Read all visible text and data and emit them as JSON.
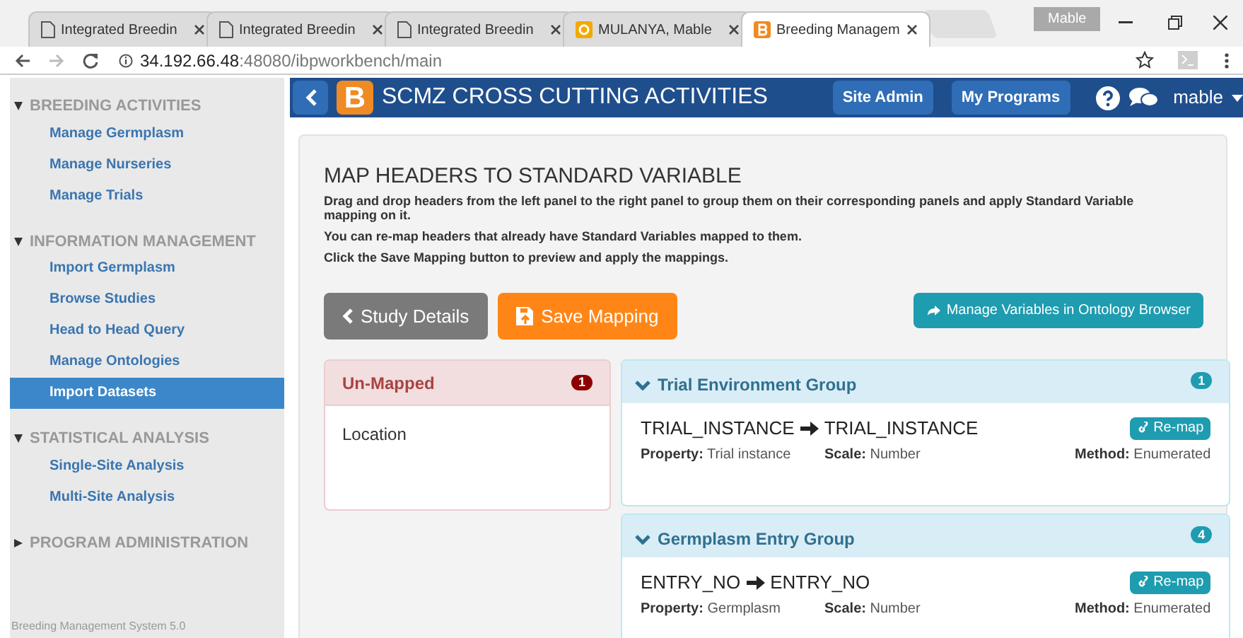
{
  "browser": {
    "tabs": [
      {
        "title": "Integrated Breedin",
        "kind": "page",
        "selected": false
      },
      {
        "title": "Integrated Breedin",
        "kind": "page",
        "selected": false
      },
      {
        "title": "Integrated Breedin",
        "kind": "page",
        "selected": false
      },
      {
        "title": "MULANYA, Mable",
        "kind": "mail",
        "selected": false
      },
      {
        "title": "Breeding Managem",
        "kind": "app",
        "selected": true
      }
    ],
    "profile": "Mable",
    "url_host": "34.192.66.48",
    "url_rest": ":48080/ibpworkbench/main"
  },
  "sidebar": {
    "sections": [
      {
        "title": "BREEDING ACTIVITIES",
        "expanded": true,
        "items": [
          {
            "label": "Manage Germplasm",
            "selected": false
          },
          {
            "label": "Manage Nurseries",
            "selected": false
          },
          {
            "label": "Manage Trials",
            "selected": false
          }
        ]
      },
      {
        "title": "INFORMATION MANAGEMENT",
        "expanded": true,
        "items": [
          {
            "label": "Import Germplasm",
            "selected": false
          },
          {
            "label": "Browse Studies",
            "selected": false
          },
          {
            "label": "Head to Head Query",
            "selected": false
          },
          {
            "label": "Manage Ontologies",
            "selected": false
          },
          {
            "label": "Import Datasets",
            "selected": true
          }
        ]
      },
      {
        "title": "STATISTICAL ANALYSIS",
        "expanded": true,
        "items": [
          {
            "label": "Single-Site Analysis",
            "selected": false
          },
          {
            "label": "Multi-Site Analysis",
            "selected": false
          }
        ]
      },
      {
        "title": "PROGRAM ADMINISTRATION",
        "expanded": false
      }
    ],
    "footer": "Breeding Management System 5.0"
  },
  "header": {
    "logo": "B",
    "title": "SCMZ CROSS CUTTING ACTIVITIES",
    "buttons": [
      "Site Admin",
      "My Programs"
    ],
    "user": "mable"
  },
  "page": {
    "title": "MAP HEADERS TO STANDARD VARIABLE",
    "paragraphs": [
      "Drag and drop headers from the left panel to the right panel to group them on their corresponding panels and apply Standard Variable mapping on it.",
      "You can re-map headers that already have Standard Variables mapped to them.",
      "Click the Save Mapping button to preview and apply the mappings."
    ],
    "study_details": "Study Details",
    "save_mapping": "Save Mapping",
    "manage_variables": "Manage Variables in Ontology Browser",
    "unmapped": {
      "title": "Un-Mapped",
      "count": "1",
      "items": [
        "Location"
      ]
    },
    "groups": [
      {
        "title": "Trial Environment Group",
        "count": "1",
        "expanded": true,
        "rows": [
          {
            "header": "TRIAL_INSTANCE",
            "variable": "TRIAL_INSTANCE",
            "action": "Re-map",
            "fields": [
              {
                "label": "Property:",
                "value": "Trial instance"
              },
              {
                "label": "Scale:",
                "value": "Number"
              },
              {
                "label": "Method:",
                "value": "Enumerated"
              }
            ]
          }
        ]
      },
      {
        "title": "Germplasm Entry Group",
        "count": "4",
        "expanded": true,
        "rows": [
          {
            "header": "ENTRY_NO",
            "variable": "ENTRY_NO",
            "action": "Re-map",
            "fields": [
              {
                "label": "Property:",
                "value": "Germplasm"
              },
              {
                "label": "Scale:",
                "value": "Number"
              },
              {
                "label": "Method:",
                "value": "Enumerated"
              }
            ]
          }
        ]
      }
    ]
  }
}
